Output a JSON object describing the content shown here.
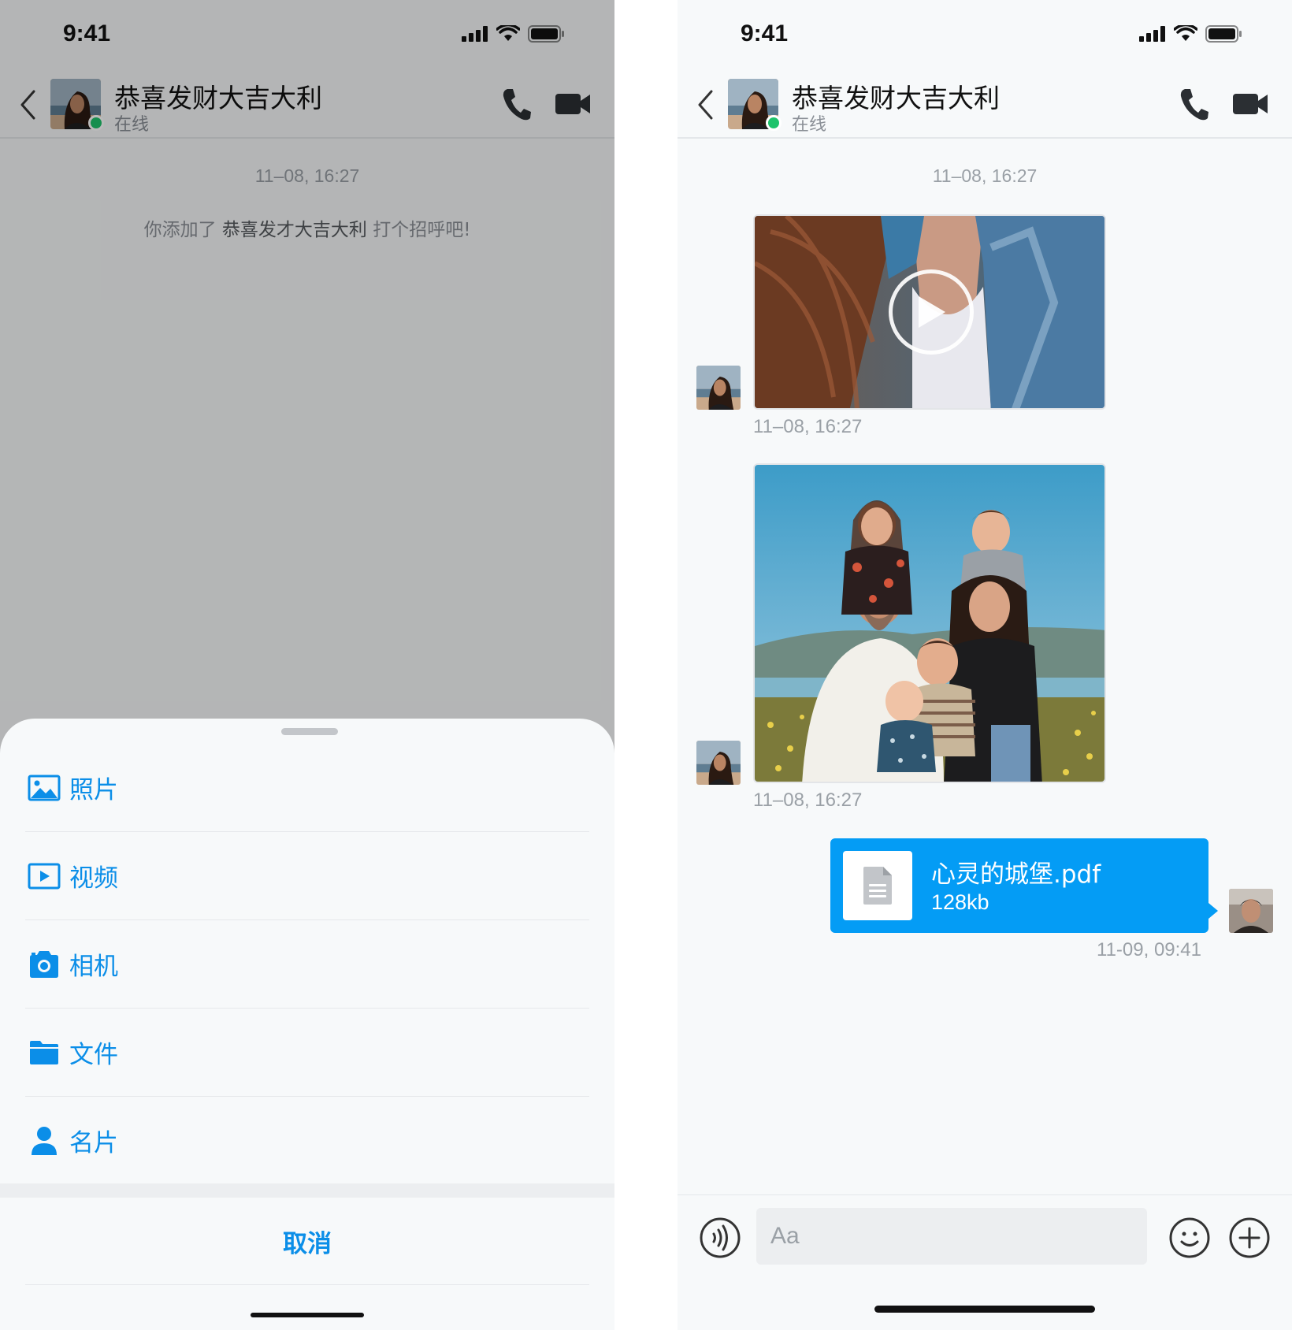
{
  "status_bar": {
    "time": "9:41",
    "icons": [
      "signal-icon",
      "wifi-icon",
      "battery-icon"
    ]
  },
  "contact": {
    "name": "恭喜发财大吉大利",
    "status": "在线",
    "online_color": "#1ec36b"
  },
  "left_screen": {
    "timestamp": "11–08, 16:27",
    "system_message": {
      "prefix": "你添加了 ",
      "name": "恭喜发才大吉大利",
      "suffix": " 打个招呼吧!"
    },
    "action_sheet": {
      "items": [
        {
          "label": "照片",
          "icon": "photo-icon"
        },
        {
          "label": "视频",
          "icon": "video-play-icon"
        },
        {
          "label": "相机",
          "icon": "camera-icon"
        },
        {
          "label": "文件",
          "icon": "folder-icon"
        },
        {
          "label": "名片",
          "icon": "person-icon"
        }
      ],
      "cancel_label": "取消"
    }
  },
  "right_screen": {
    "timestamp": "11–08, 16:27",
    "messages": [
      {
        "type": "video",
        "time": "11–08, 16:27"
      },
      {
        "type": "image",
        "time": "11–08, 16:27"
      },
      {
        "type": "file",
        "file_name": "心灵的城堡.pdf",
        "file_size": "128kb",
        "time": "11-09, 09:41"
      }
    ],
    "composer": {
      "placeholder": "Aa"
    }
  },
  "colors": {
    "accent": "#049cf5",
    "accent_text": "#0b8ee8",
    "online": "#1ec36b"
  }
}
